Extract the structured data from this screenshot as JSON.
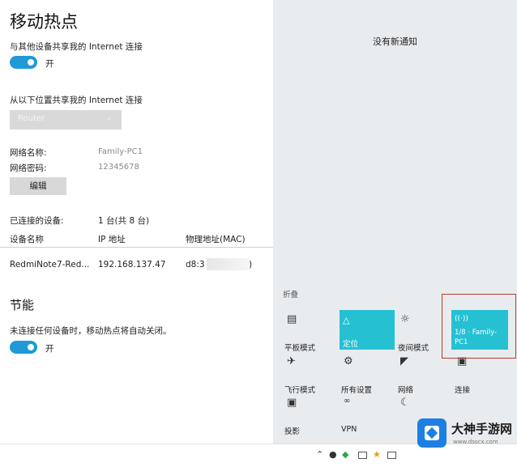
{
  "hotspot": {
    "title": "移动热点",
    "share_label": "与其他设备共享我的 Internet 连接",
    "share_state": "开",
    "share_from_label": "从以下位置共享我的 Internet 连接",
    "share_from_value": "Router",
    "network_name_label": "网络名称:",
    "network_name_value": "Family-PC1",
    "network_password_label": "网络密码:",
    "network_password_value": "12345678",
    "edit_button": "编辑",
    "connected_label": "已连接的设备:",
    "connected_value": "1 台(共 8 台)",
    "columns": [
      "设备名称",
      "IP 地址",
      "物理地址(MAC)"
    ],
    "devices": [
      {
        "name": "RedmiNote7-Red...",
        "ip": "192.168.137.47",
        "mac": "d8:3"
      }
    ]
  },
  "power_saving": {
    "title": "节能",
    "description": "未连接任何设备时，移动热点将自动关闭。",
    "state": "开"
  },
  "action_center": {
    "no_notifications": "没有新通知",
    "collapse": "折叠",
    "tiles": [
      {
        "label": "平板模式",
        "icon": "tablet-icon",
        "active": false
      },
      {
        "label": "定位",
        "icon": "location-icon",
        "active": true
      },
      {
        "label": "夜间模式",
        "icon": "brightness-icon",
        "active": false
      },
      {
        "label": "1/8 · Family-",
        "sub": "PC1",
        "icon": "hotspot-icon",
        "active": true
      },
      {
        "label": "飞行模式",
        "icon": "airplane-icon",
        "active": false
      },
      {
        "label": "所有设置",
        "icon": "gear-icon",
        "active": false
      },
      {
        "label": "网络",
        "icon": "network-icon",
        "active": false
      },
      {
        "label": "连接",
        "icon": "connect-icon",
        "active": false
      },
      {
        "label": "投影",
        "icon": "project-icon",
        "active": false
      },
      {
        "label": "VPN",
        "icon": "vpn-icon",
        "active": false
      },
      {
        "label": "",
        "icon": "moon-icon",
        "active": false
      }
    ]
  },
  "watermark": {
    "brand": "大神手游网",
    "url": "www.dsscx.com"
  },
  "colors": {
    "accent": "#1f9ad6",
    "tile_active": "#26c0d3",
    "highlight": "#c0392b"
  }
}
